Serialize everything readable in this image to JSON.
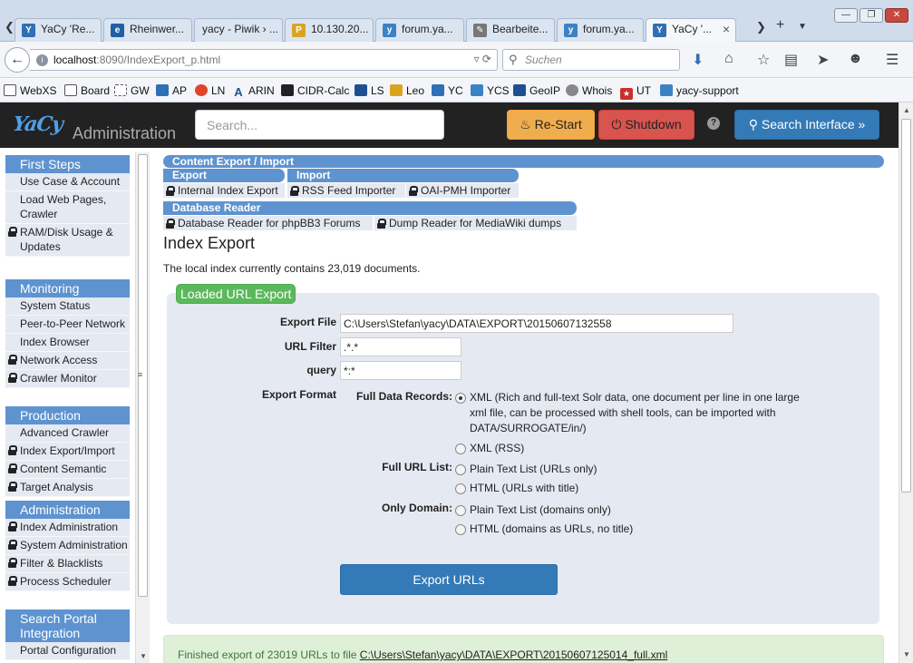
{
  "browser": {
    "tabs": [
      {
        "label": "YaCy 'Re...",
        "color": "#2f6fb5",
        "glyph": "Y"
      },
      {
        "label": "Rheinwer...",
        "color": "#1f5fa8",
        "glyph": "e"
      },
      {
        "label": "yacy - Piwik › ...",
        "color": "#ffffff",
        "glyph": ""
      },
      {
        "label": "10.130.20...",
        "color": "#d9a521",
        "glyph": "P"
      },
      {
        "label": "forum.ya...",
        "color": "#3b82c4",
        "glyph": "y"
      },
      {
        "label": "Bearbeite...",
        "color": "#777777",
        "glyph": "✎"
      },
      {
        "label": "forum.ya...",
        "color": "#3b82c4",
        "glyph": "y"
      },
      {
        "label": "YaCy '...",
        "color": "#2f6fb5",
        "glyph": "Y"
      }
    ],
    "url_host": "localhost",
    "url_path": ":8090/IndexExport_p.html",
    "search_placeholder": "Suchen",
    "bookmarks": [
      {
        "label": "WebXS",
        "color": "#ffffff"
      },
      {
        "label": "Board",
        "color": "#ffffff"
      },
      {
        "label": "GW",
        "color": "#ffffff"
      },
      {
        "label": "AP",
        "color": "#2f6fb5"
      },
      {
        "label": "LN",
        "color": "#e0442c"
      },
      {
        "label": "ARIN",
        "color": "#1f4f8f"
      },
      {
        "label": "CIDR-Calc",
        "color": "#222222"
      },
      {
        "label": "LS",
        "color": "#1f4f8f"
      },
      {
        "label": "Leo",
        "color": "#d9a521"
      },
      {
        "label": "YC",
        "color": "#2f6fb5"
      },
      {
        "label": "YCS",
        "color": "#3b82c4"
      },
      {
        "label": "GeoIP",
        "color": "#1f4f8f"
      },
      {
        "label": "Whois",
        "color": "#888888"
      },
      {
        "label": "UT",
        "color": "#c9302c"
      },
      {
        "label": "yacy-support",
        "color": "#3b82c4"
      }
    ]
  },
  "header": {
    "logo": "YaCy",
    "admin_title": "Administration",
    "search_placeholder": "Search...",
    "restart_label": "Re-Start",
    "shutdown_label": "Shutdown",
    "help_label": "?",
    "search_interface_label": "Search Interface »"
  },
  "sidebar": {
    "groups": [
      {
        "title": "First Steps",
        "items": [
          {
            "label": "Use Case & Account",
            "locked": false
          },
          {
            "label": "Load Web Pages, Crawler",
            "locked": false
          },
          {
            "label": "RAM/Disk Usage & Updates",
            "locked": true
          }
        ]
      },
      {
        "title": "Monitoring",
        "items": [
          {
            "label": "System Status",
            "locked": false
          },
          {
            "label": "Peer-to-Peer Network",
            "locked": false
          },
          {
            "label": "Index Browser",
            "locked": false
          },
          {
            "label": "Network Access",
            "locked": true
          },
          {
            "label": "Crawler Monitor",
            "locked": true
          }
        ]
      },
      {
        "title": "Production",
        "items": [
          {
            "label": "Advanced Crawler",
            "locked": false
          },
          {
            "label": "Index Export/Import",
            "locked": true
          },
          {
            "label": "Content Semantic",
            "locked": true
          },
          {
            "label": "Target Analysis",
            "locked": true
          }
        ]
      },
      {
        "title": "Administration",
        "items": [
          {
            "label": "Index Administration",
            "locked": true
          },
          {
            "label": "System Administration",
            "locked": true
          },
          {
            "label": "Filter & Blacklists",
            "locked": true
          },
          {
            "label": "Process Scheduler",
            "locked": true
          }
        ]
      },
      {
        "title": "Search Portal Integration",
        "items": [
          {
            "label": "Portal Configuration",
            "locked": false
          }
        ]
      }
    ]
  },
  "submenu": {
    "title": "Content Export / Import",
    "export_title": "Export",
    "import_title": "Import",
    "export_items": [
      "Internal Index Export"
    ],
    "import_items": [
      "RSS Feed Importer",
      "OAI-PMH Importer"
    ],
    "reader_title": "Database Reader",
    "reader_items": [
      "Database Reader for phpBB3 Forums",
      "Dump Reader for MediaWiki dumps"
    ]
  },
  "main": {
    "title": "Index Export",
    "intro": "The local index currently contains 23,019 documents.",
    "legend": "Loaded URL Export",
    "export_file_label": "Export File",
    "export_file_value": "C:\\Users\\Stefan\\yacy\\DATA\\EXPORT\\20150607132558",
    "url_filter_label": "URL Filter",
    "url_filter_value": ".*.*",
    "query_label": "query",
    "query_value": "*:*",
    "export_format_label": "Export Format",
    "full_data_label": "Full Data Records:",
    "opt_xml_solr": "XML (Rich and full-text Solr data, one document per line in one large xml file, can be processed with shell tools, can be imported with DATA/SURROGATE/in/)",
    "opt_xml_rss": "XML (RSS)",
    "full_url_label": "Full URL List:",
    "opt_plain_urls": "Plain Text List (URLs only)",
    "opt_html_urls": "HTML (URLs with title)",
    "only_domain_label": "Only Domain:",
    "opt_plain_domains": "Plain Text List (domains only)",
    "opt_html_domains": "HTML (domains as URLs, no title)",
    "export_button": "Export URLs",
    "success_text": "Finished export of 23019 URLs to file ",
    "success_file": "C:\\Users\\Stefan\\yacy\\DATA\\EXPORT\\20150607125014_full.xml"
  }
}
